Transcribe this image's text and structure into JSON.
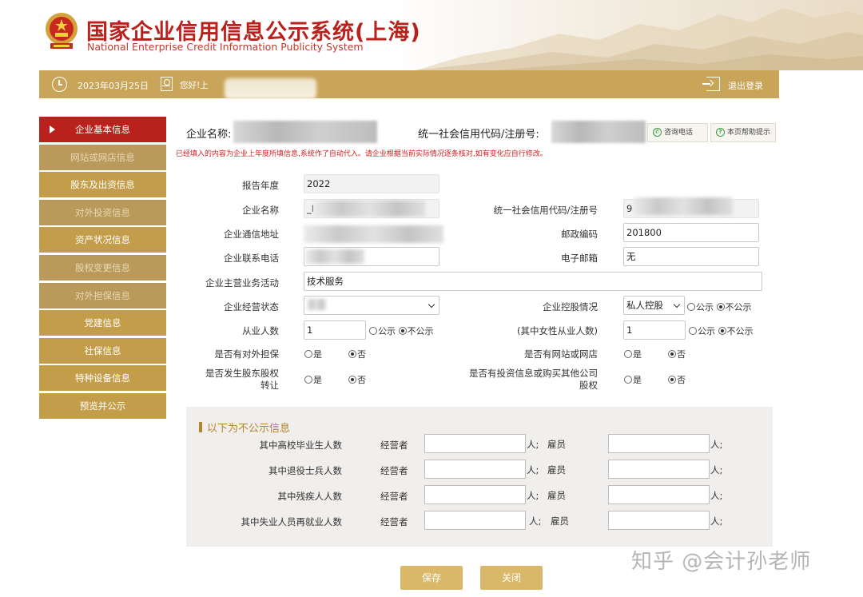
{
  "header": {
    "title_cn": "国家企业信用信息公示系统(上海)",
    "title_en": "National Enterprise Credit Information Publicity System"
  },
  "topbar": {
    "date": "2023年03月25日",
    "greeting": "您好!上",
    "logout": "退出登录"
  },
  "sidebar": {
    "items": [
      {
        "label": "企业基本信息",
        "state": "active"
      },
      {
        "label": "网站或网店信息",
        "state": "muted"
      },
      {
        "label": "股东及出资信息",
        "state": "normal"
      },
      {
        "label": "对外投资信息",
        "state": "muted"
      },
      {
        "label": "资产状况信息",
        "state": "normal"
      },
      {
        "label": "股权变更信息",
        "state": "muted"
      },
      {
        "label": "对外担保信息",
        "state": "muted"
      },
      {
        "label": "党建信息",
        "state": "normal"
      },
      {
        "label": "社保信息",
        "state": "normal"
      },
      {
        "label": "特种设备信息",
        "state": "normal"
      },
      {
        "label": "预览并公示",
        "state": "normal"
      }
    ]
  },
  "company": {
    "name_label": "企业名称:",
    "code_label": "统一社会信用代码/注册号:",
    "consult_btn": "咨询电话",
    "help_btn": "本页帮助提示",
    "notice": "已经填入的内容为企业上年度所填信息,系统作了自动代入。请企业根据当前实际情况逐条核对,如有变化应自行修改。"
  },
  "form": {
    "report_year_label": "报告年度",
    "report_year": "2022",
    "company_name_label": "企业名称",
    "company_name_prefix": "_I",
    "credit_code_label": "统一社会信用代码/注册号",
    "credit_code_prefix": "9",
    "address_label": "企业通信地址",
    "postcode_label": "邮政编码",
    "postcode": "201800",
    "phone_label": "企业联系电话",
    "email_label": "电子邮箱",
    "email": "无",
    "business_label": "企业主营业务活动",
    "business": "技术服务",
    "status_label": "企业经营状态",
    "control_label": "企业控股情况",
    "control_value": "私人控股",
    "employees_label": "从业人数",
    "employees": "1",
    "female_label": "(其中女性从业人数)",
    "female": "1",
    "guarantee_label": "是否有对外担保",
    "website_label": "是否有网站或网店",
    "equity_transfer_label_1": "是否发生股东股权",
    "equity_transfer_label_2": "转让",
    "invest_label_1": "是否有投资信息或购买其他公司",
    "invest_label_2": "股权",
    "opt_public": "公示",
    "opt_not_public": "不公示",
    "opt_yes": "是",
    "opt_no": "否"
  },
  "nonpublic": {
    "title": "以下为不公示信息",
    "operator_label": "经营者",
    "employee_label": "雇员",
    "unit_person": "人;",
    "unit_person_sep": "人; ",
    "rows": [
      {
        "label": "其中高校毕业生人数"
      },
      {
        "label": "其中退役士兵人数"
      },
      {
        "label": "其中残疾人人数"
      },
      {
        "label": "其中失业人员再就业人数"
      }
    ]
  },
  "buttons": {
    "save": "保存",
    "close": "关闭"
  },
  "watermark": "知乎 @会计孙老师",
  "colors": {
    "gold": "#c9a55a",
    "red": "#b8211c",
    "button": "#d9b869"
  }
}
